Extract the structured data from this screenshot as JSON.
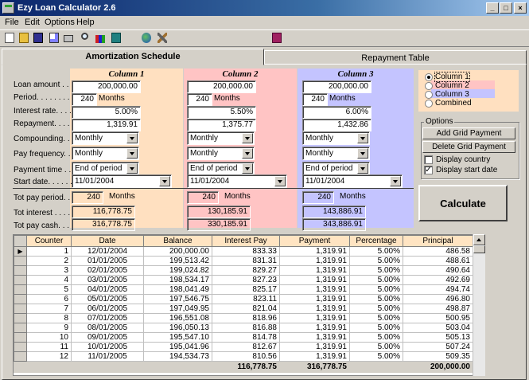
{
  "app": {
    "title": "Ezy Loan Calculator  2.6"
  },
  "menu": [
    "File",
    "Edit",
    "Options",
    "Help"
  ],
  "toolbar": {
    "icons": [
      "new-icon",
      "open-icon",
      "save-icon",
      "print-preview-icon",
      "print-icon",
      "search-icon",
      "chart-icon",
      "table-icon",
      "globe-icon",
      "tools-icon",
      "help-book-icon"
    ]
  },
  "tabs": [
    "Amortization Schedule",
    "Repayment Table"
  ],
  "labels": {
    "loan_amount": "Loan amount . . .",
    "period": "Period. . . . . . . . .",
    "interest_rate": "Interest rate. . . .",
    "repayment": "Repayment. . . . .",
    "compounding": "Compounding. . .",
    "pay_frequency": "Pay frequency. . .",
    "payment_time": "Payment time . . .",
    "start_date": "Start date. . . . . .",
    "tot_pay_period": "Tot pay period. .",
    "tot_interest": "Tot interest . . . .",
    "tot_pay_cash": "Tot pay cash. . ."
  },
  "columns": [
    {
      "title": "Column 1",
      "color": "#ffe0c0",
      "loan_amount": "200,000.00",
      "period": "240",
      "period_unit": "Months",
      "interest_rate": "5.00%",
      "repayment": "1,319.91",
      "compounding": "Monthly",
      "pay_frequency": "Monthly",
      "payment_time": "End of period",
      "start_date": "11/01/2004",
      "tot_pay_period": "240",
      "tot_unit": "Months",
      "tot_interest": "116,778.75",
      "tot_pay_cash": "316,778.75"
    },
    {
      "title": "Column 2",
      "color": "#ffc4c4",
      "loan_amount": "200,000.00",
      "period": "240",
      "period_unit": "Months",
      "interest_rate": "5.50%",
      "repayment": "1,375.77",
      "compounding": "Monthly",
      "pay_frequency": "Monthly",
      "payment_time": "End of period",
      "start_date": "11/01/2004",
      "tot_pay_period": "240",
      "tot_unit": "Months",
      "tot_interest": "130,185.91",
      "tot_pay_cash": "330,185.91"
    },
    {
      "title": "Column 3",
      "color": "#c4c4ff",
      "loan_amount": "200,000.00",
      "period": "240",
      "period_unit": "Months",
      "interest_rate": "6.00%",
      "repayment": "1,432.86",
      "compounding": "Monthly",
      "pay_frequency": "Monthly",
      "payment_time": "End of period",
      "start_date": "11/01/2004",
      "tot_pay_period": "240",
      "tot_unit": "Months",
      "tot_interest": "143,886.91",
      "tot_pay_cash": "343,886.91"
    }
  ],
  "column_select": {
    "options": [
      "Column 1",
      "Column 2",
      "Column 3",
      "Combined"
    ],
    "selected": "Column 1"
  },
  "options": {
    "title": "Options",
    "add_grid_payment": "Add Grid Payment",
    "delete_grid_payment": "Delete Grid Payment",
    "display_country": "Display country",
    "display_country_checked": false,
    "display_start_date": "Display start date",
    "display_start_date_checked": true
  },
  "calculate_label": "Calculate",
  "grid": {
    "headers": [
      "Counter",
      "Date",
      "Balance",
      "Interest Pay",
      "Payment",
      "Percentage",
      "Principal"
    ],
    "rows": [
      [
        "1",
        "12/01/2004",
        "200,000.00",
        "833.33",
        "1,319.91",
        "5.00%",
        "486.58"
      ],
      [
        "2",
        "01/01/2005",
        "199,513.42",
        "831.31",
        "1,319.91",
        "5.00%",
        "488.61"
      ],
      [
        "3",
        "02/01/2005",
        "199,024.82",
        "829.27",
        "1,319.91",
        "5.00%",
        "490.64"
      ],
      [
        "4",
        "03/01/2005",
        "198,534.17",
        "827.23",
        "1,319.91",
        "5.00%",
        "492.69"
      ],
      [
        "5",
        "04/01/2005",
        "198,041.49",
        "825.17",
        "1,319.91",
        "5.00%",
        "494.74"
      ],
      [
        "6",
        "05/01/2005",
        "197,546.75",
        "823.11",
        "1,319.91",
        "5.00%",
        "496.80"
      ],
      [
        "7",
        "06/01/2005",
        "197,049.95",
        "821.04",
        "1,319.91",
        "5.00%",
        "498.87"
      ],
      [
        "8",
        "07/01/2005",
        "196,551.08",
        "818.96",
        "1,319.91",
        "5.00%",
        "500.95"
      ],
      [
        "9",
        "08/01/2005",
        "196,050.13",
        "816.88",
        "1,319.91",
        "5.00%",
        "503.04"
      ],
      [
        "10",
        "09/01/2005",
        "195,547.10",
        "814.78",
        "1,319.91",
        "5.00%",
        "505.13"
      ],
      [
        "11",
        "10/01/2005",
        "195,041.96",
        "812.67",
        "1,319.91",
        "5.00%",
        "507.24"
      ],
      [
        "12",
        "11/01/2005",
        "194,534.73",
        "810.56",
        "1,319.91",
        "5.00%",
        "509.35"
      ]
    ],
    "totals": {
      "interest": "116,778.75",
      "payment": "316,778.75",
      "principal": "200,000.00"
    }
  }
}
